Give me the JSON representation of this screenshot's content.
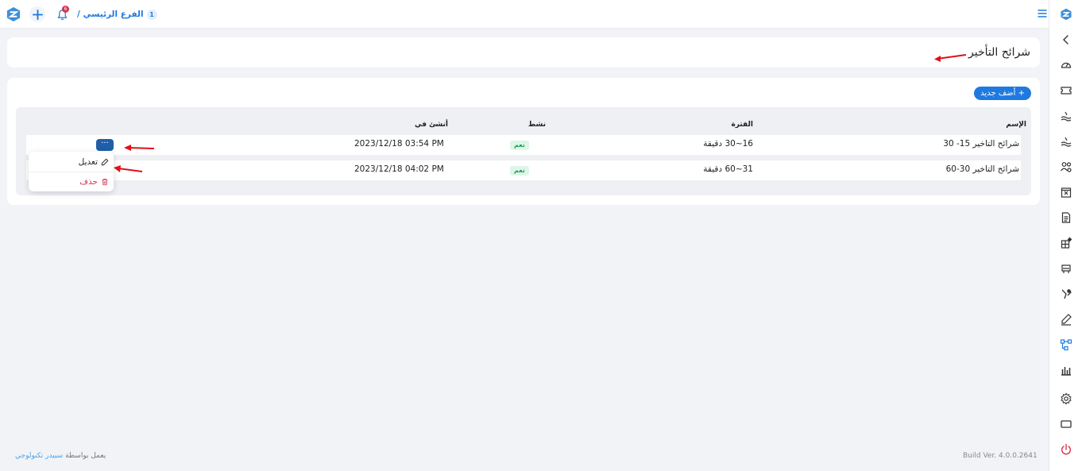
{
  "header": {
    "breadcrumb_badge": "1",
    "breadcrumb_text": "الفرع الرئيسي /",
    "notification_count": "6"
  },
  "page": {
    "title": "شرائح التأخير",
    "add_button": "+ أضف جديد"
  },
  "table": {
    "columns": {
      "name": "الإسم",
      "period": "الفترة",
      "active": "نشط",
      "created": "أنشئ في"
    },
    "rows": [
      {
        "name": "شرائح التاخير 15- 30",
        "period": "16~30 دقيقة",
        "active": "نعم",
        "created": "2023/12/18 03:54 PM"
      },
      {
        "name": "شرائح التاخير 30-60",
        "period": "31~60 دقيقة",
        "active": "نعم",
        "created": "2023/12/18 04:02 PM"
      }
    ]
  },
  "row_menu": {
    "edit": "تعديل",
    "delete": "حذف"
  },
  "footer": {
    "powered_prefix": "يعمل بواسطة",
    "powered_link": "سبيدر تكنولوجي",
    "build": "Build Ver. 4.0.0.2641"
  },
  "colors": {
    "accent": "#1f7ae0",
    "danger": "#d6334c",
    "active_badge": "#1f9d57"
  },
  "icons": [
    "brand-logo-icon",
    "add-icon",
    "bell-icon",
    "menu-icon",
    "chevron-left-icon",
    "dashboard-icon",
    "ticket-icon",
    "wave-icon",
    "wave-alt-icon",
    "users-gear-icon",
    "calendar-x-icon",
    "report-icon",
    "apps-icon",
    "devices-icon",
    "pen-check-icon",
    "signature-icon",
    "workflow-icon",
    "bar-chart-icon",
    "gear-icon",
    "rectangle-icon",
    "power-icon",
    "pencil-icon",
    "trash-icon"
  ]
}
